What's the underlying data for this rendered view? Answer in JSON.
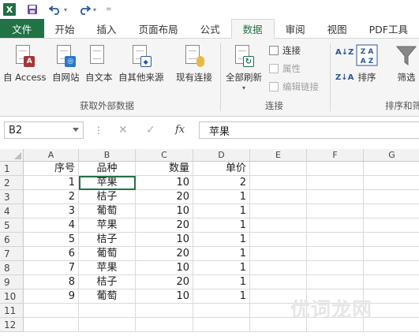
{
  "quick_access": {
    "logo_text": "X",
    "save_icon": "save-icon",
    "undo_icon": "undo-icon",
    "redo_icon": "redo-icon",
    "dropdown_glyph": "▾",
    "customize_glyph": "="
  },
  "tabs": [
    {
      "label": "文件",
      "active": false,
      "file": true
    },
    {
      "label": "开始",
      "active": false
    },
    {
      "label": "插入",
      "active": false
    },
    {
      "label": "页面布局",
      "active": false
    },
    {
      "label": "公式",
      "active": false
    },
    {
      "label": "数据",
      "active": true
    },
    {
      "label": "审阅",
      "active": false
    },
    {
      "label": "视图",
      "active": false
    },
    {
      "label": "PDF工具",
      "active": false
    }
  ],
  "ribbon": {
    "external_group": {
      "label": "获取外部数据",
      "buttons": [
        {
          "label": "自 Access",
          "icon": "access-icon",
          "badge": "A",
          "badge_color": "#a4373a"
        },
        {
          "label": "自网站",
          "icon": "web-icon",
          "badge": "◎",
          "badge_color": "#2b78c9"
        },
        {
          "label": "自文本",
          "icon": "text-file-icon",
          "badge": "",
          "badge_color": ""
        },
        {
          "label": "自其他来源",
          "icon": "other-sources-icon",
          "badge": "▾",
          "badge_color": "#666666"
        }
      ]
    },
    "existing_connections": {
      "label": "现有连接",
      "icon": "existing-connections-icon"
    },
    "connections_group": {
      "label": "连接",
      "refresh_all": {
        "label": "全部刷新",
        "dropdown": "▾",
        "icon": "refresh-all-icon"
      },
      "commands": [
        {
          "label": "连接",
          "enabled": true
        },
        {
          "label": "属性",
          "enabled": false
        },
        {
          "label": "编辑链接",
          "enabled": false
        }
      ]
    },
    "sort_group": {
      "label": "排序和筛",
      "sort_label": "排序",
      "filter_label": "筛选",
      "az_text": "A↓Z",
      "za_text": "Z↓A",
      "sort_icon_text": "Z A\nA Z"
    }
  },
  "formula_bar": {
    "name_box": "B2",
    "cancel_glyph": "✕",
    "confirm_glyph": "✓",
    "fx_label": "fx",
    "content": "苹果"
  },
  "sheet": {
    "columns": [
      "A",
      "B",
      "C",
      "D",
      "E",
      "F",
      "G"
    ],
    "row_numbers": [
      "1",
      "2",
      "3",
      "4",
      "5",
      "6",
      "7",
      "8",
      "9",
      "10",
      "11",
      "12"
    ],
    "selected_cell": "B2",
    "rows": [
      [
        "序号",
        "品种",
        "数量",
        "单价"
      ],
      [
        "1",
        "苹果",
        "10",
        "2"
      ],
      [
        "2",
        "桔子",
        "20",
        "1"
      ],
      [
        "3",
        "葡萄",
        "10",
        "1"
      ],
      [
        "4",
        "苹果",
        "20",
        "1"
      ],
      [
        "5",
        "桔子",
        "10",
        "1"
      ],
      [
        "6",
        "葡萄",
        "20",
        "1"
      ],
      [
        "7",
        "苹果",
        "10",
        "1"
      ],
      [
        "8",
        "桔子",
        "20",
        "1"
      ],
      [
        "9",
        "葡萄",
        "10",
        "1"
      ]
    ]
  },
  "watermark": "优词龙网",
  "colors": {
    "excel_green": "#217346",
    "ribbon_bg": "#f5f5f5",
    "header_bg": "#f2f2f2"
  }
}
